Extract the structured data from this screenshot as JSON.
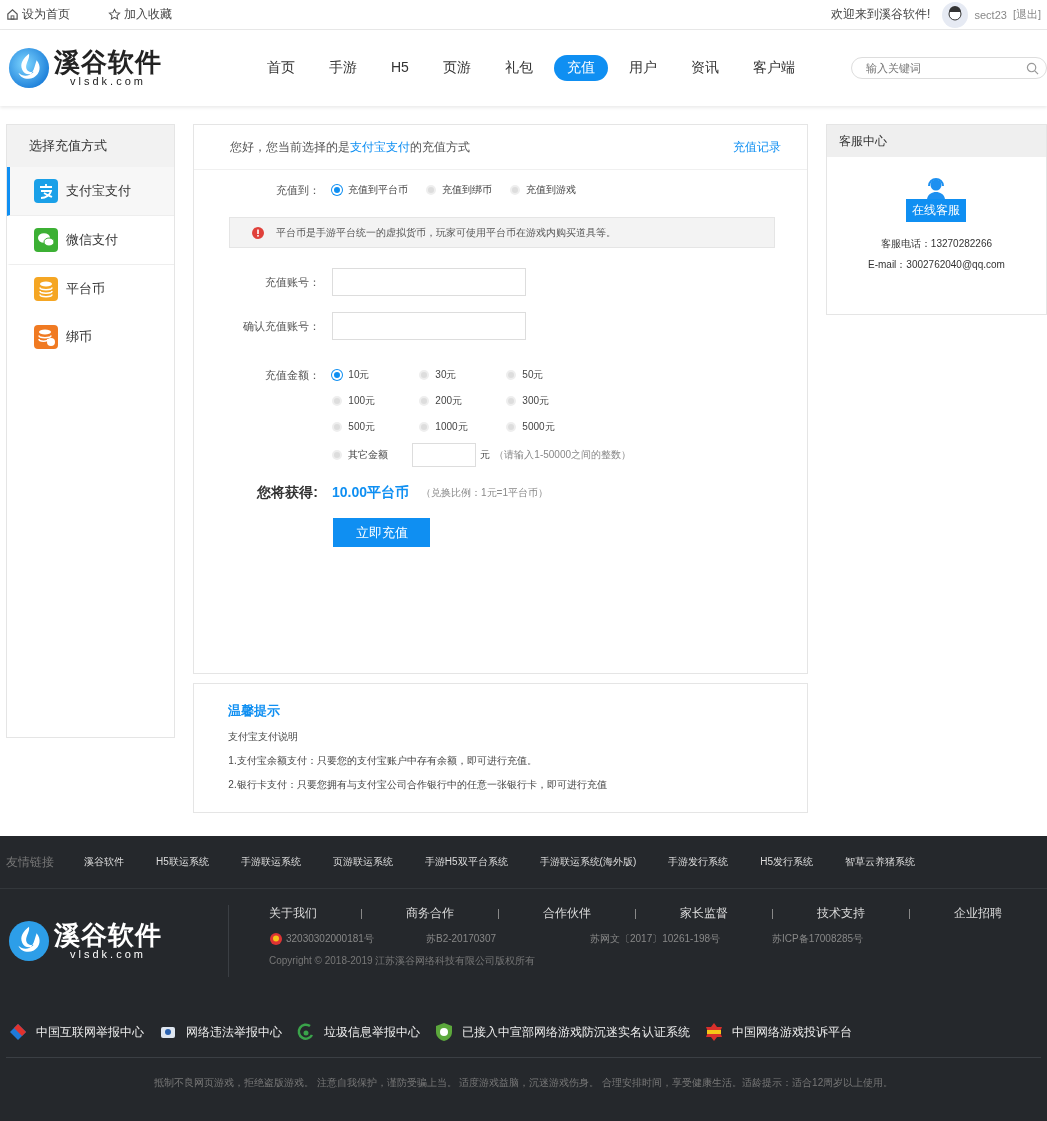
{
  "topbar": {
    "links": [
      {
        "label": "设为首页",
        "kind": "home"
      },
      {
        "label": "加入收藏",
        "kind": "star"
      }
    ],
    "welcome": "欢迎来到溪谷软件!",
    "user": "sect23",
    "logout": "[退出]"
  },
  "header": {
    "logo_name": "溪谷软件",
    "logo_domain": "vlsdk.com",
    "nav": [
      {
        "label": "首页",
        "selected": false
      },
      {
        "label": "手游",
        "selected": false
      },
      {
        "label": "H5",
        "selected": false
      },
      {
        "label": "页游",
        "selected": false
      },
      {
        "label": "礼包",
        "selected": false
      },
      {
        "label": "充值",
        "selected": true
      },
      {
        "label": "用户",
        "selected": false
      },
      {
        "label": "资讯",
        "selected": false
      },
      {
        "label": "客户端",
        "selected": false
      }
    ],
    "search": {
      "placeholder": "输入关键词"
    }
  },
  "sidebar": {
    "title": "选择充值方式",
    "items": [
      {
        "label": "支付宝支付",
        "kind": "alipay",
        "selected": true
      },
      {
        "label": "微信支付",
        "kind": "wechat",
        "selected": false
      },
      {
        "label": "平台币",
        "kind": "coin",
        "selected": false
      },
      {
        "label": "绑币",
        "kind": "bound",
        "selected": false
      }
    ]
  },
  "main": {
    "intro": "您好，您当前选择的是",
    "intro_method": "支付宝支付",
    "intro_end": "的充值方式",
    "records_link": "充值记录",
    "target": {
      "label": "充值到：",
      "options": [
        {
          "label": "充值到平台币",
          "selected": true
        },
        {
          "label": "充值到绑币",
          "selected": false
        },
        {
          "label": "充值到游戏",
          "selected": false
        }
      ]
    },
    "notice": "平台币是手游平台统一的虚拟货币，玩家可使用平台币在游戏内购买道具等。",
    "account_label": "充值账号：",
    "confirm_label": "确认充值账号：",
    "amount": {
      "label": "充值金额：",
      "options": [
        {
          "label": "10元",
          "selected": true
        },
        {
          "label": "30元",
          "selected": false
        },
        {
          "label": "50元",
          "selected": false
        },
        {
          "label": "100元",
          "selected": false
        },
        {
          "label": "200元",
          "selected": false
        },
        {
          "label": "300元",
          "selected": false
        },
        {
          "label": "500元",
          "selected": false
        },
        {
          "label": "1000元",
          "selected": false
        },
        {
          "label": "5000元",
          "selected": false
        }
      ],
      "other": {
        "label": "其它金额",
        "selected": false,
        "unit": "元",
        "hint": "（请输入1-50000之间的整数）"
      }
    },
    "gain": {
      "label": "您将获得:",
      "value": "10.00平台币",
      "ratio": "（兑换比例：1元=1平台币）"
    },
    "submit": "立即充值"
  },
  "tips": {
    "title": "温馨提示",
    "lines": [
      "支付宝支付说明",
      "1.支付宝余额支付：只要您的支付宝账户中存有余额，即可进行充值。",
      "2.银行卡支付：只要您拥有与支付宝公司合作银行中的任意一张银行卡，即可进行充值"
    ]
  },
  "service": {
    "title": "客服中心",
    "button": "在线客服",
    "phone": "客服电话：13270282266",
    "email": "E-mail：3002762040@qq.com"
  },
  "footer": {
    "logo_name": "溪谷软件",
    "logo_domain": "vlsdk.com",
    "links_label": "友情链接",
    "links": [
      "溪谷软件",
      "H5联运系统",
      "手游联运系统",
      "页游联运系统",
      "手游H5双平台系统",
      "手游联运系统(海外版)",
      "手游发行系统",
      "H5发行系统",
      "智草云养猪系统"
    ],
    "about": [
      "关于我们",
      "商务合作",
      "合作伙伴",
      "家长监督",
      "技术支持",
      "企业招聘"
    ],
    "records": [
      {
        "label": "32030302000181号",
        "kind": "police"
      },
      {
        "label": "苏B2-20170307",
        "kind": "none"
      },
      {
        "label": "苏网文〔2017〕10261-198号",
        "kind": "none"
      },
      {
        "label": "苏ICP备17008285号",
        "kind": "none"
      }
    ],
    "copyright": "Copyright © 2018-2019 江苏溪谷网络科技有限公司版权所有",
    "reports": [
      {
        "label": "中国互联网举报中心",
        "kind": "internet"
      },
      {
        "label": "网络违法举报中心",
        "kind": "police-car"
      },
      {
        "label": "垃圾信息举报中心",
        "kind": "spam"
      },
      {
        "label": "已接入中宣部网络游戏防沉迷实名认证系统",
        "kind": "shield"
      },
      {
        "label": "中国网络游戏投诉平台",
        "kind": "game"
      }
    ],
    "slogan": "抵制不良网页游戏，拒绝盗版游戏。 注意自我保护，谨防受骗上当。 适度游戏益脑，沉迷游戏伤身。 合理安排时间，享受健康生活。适龄提示：适合12周岁以上使用。"
  }
}
